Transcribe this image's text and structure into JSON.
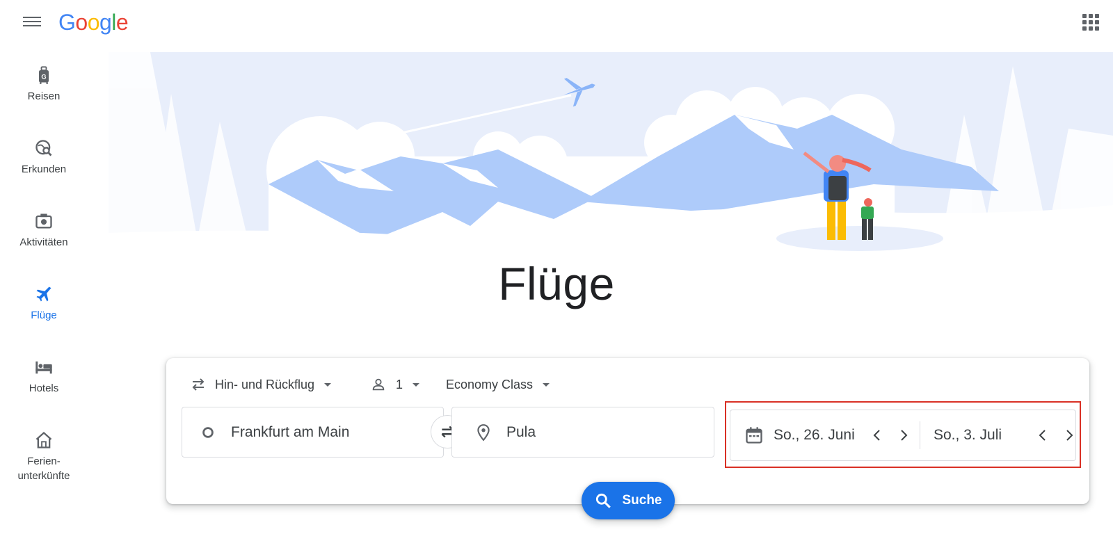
{
  "header": {
    "logo_letters": [
      "G",
      "o",
      "o",
      "g",
      "l",
      "e"
    ]
  },
  "sidebar": {
    "items": [
      {
        "label": "Reisen",
        "icon": "travel-bag-icon"
      },
      {
        "label": "Erkunden",
        "icon": "explore-globe-icon"
      },
      {
        "label": "Aktivitäten",
        "icon": "camera-icon"
      },
      {
        "label": "Flüge",
        "icon": "airplane-icon",
        "active": true
      },
      {
        "label": "Hotels",
        "icon": "bed-icon"
      },
      {
        "label_line1": "Ferien-",
        "label_line2": "unterkünfte",
        "icon": "house-icon"
      }
    ]
  },
  "hero": {
    "title": "Flüge"
  },
  "search": {
    "trip_type": "Hin- und Rückflug",
    "passengers": "1",
    "cabin_class": "Economy Class",
    "origin": "Frankfurt am Main",
    "destination": "Pula",
    "depart_date": "So., 26. Juni",
    "return_date": "So., 3. Juli",
    "search_label": "Suche"
  },
  "colors": {
    "accent": "#1a73e8",
    "highlight_border": "#d93025",
    "hero_sky": "#e8eefb",
    "hero_mountain": "#aecbfa"
  }
}
